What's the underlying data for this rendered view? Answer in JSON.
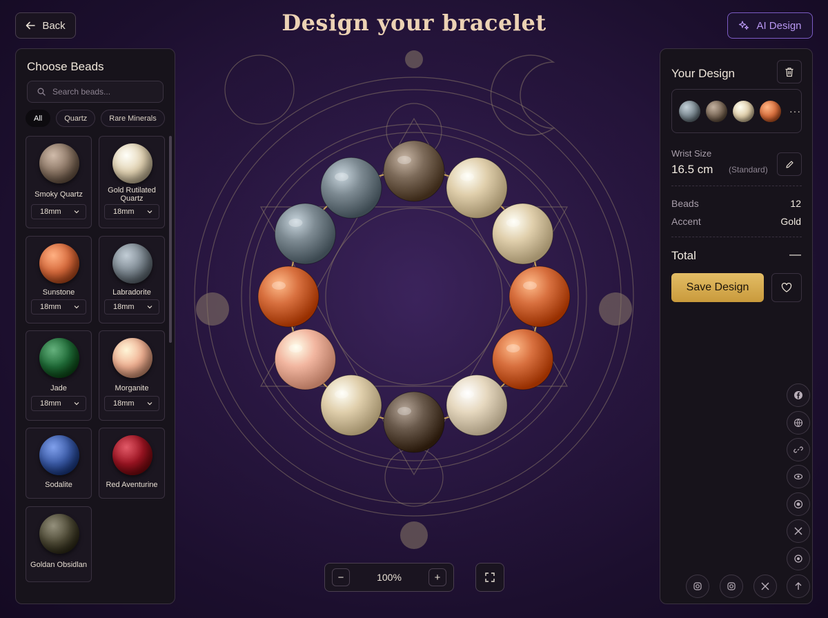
{
  "header": {
    "back_label": "Back",
    "title": "Design your bracelet",
    "ai_label": "AI Design"
  },
  "colors": {
    "accent_gold": "#d4aa52",
    "accent_purple": "#8e6ad8",
    "panel_bg": "#17131b",
    "background": "#2a1742"
  },
  "left_panel": {
    "title": "Choose Beads",
    "search_placeholder": "Search beads...",
    "filters": [
      "All",
      "Quartz",
      "Rare Minerals"
    ],
    "active_filter": "All",
    "beads": [
      {
        "name": "Smoky Quartz",
        "size": "18mm",
        "color": "#8a7564"
      },
      {
        "name": "Gold Rutilated Quartz",
        "size": "18mm",
        "color": "#e2d3b3"
      },
      {
        "name": "Sunstone",
        "size": "18mm",
        "color": "#d76a3c"
      },
      {
        "name": "Labradorite",
        "size": "18mm",
        "color": "#7c8790"
      },
      {
        "name": "Jade",
        "size": "18mm",
        "color": "#1f6b37"
      },
      {
        "name": "Morganite",
        "size": "18mm",
        "color": "#f0b092"
      },
      {
        "name": "Sodalite",
        "size": "",
        "color": "#3a5aa6"
      },
      {
        "name": "Red Aventurine",
        "size": "",
        "color": "#9c1422"
      },
      {
        "name": "Goldan Obsidlan",
        "size": "",
        "color": "#4e4a36"
      }
    ]
  },
  "canvas": {
    "bracelet_beads": [
      {
        "stone": "Smoky Quartz",
        "color": "#7d6b5a"
      },
      {
        "stone": "Gold Rutilated Quartz",
        "color": "#e0cfac"
      },
      {
        "stone": "Gold Rutilated Quartz",
        "color": "#e0cfac"
      },
      {
        "stone": "Sunstone",
        "color": "#d8703f"
      },
      {
        "stone": "Sunstone",
        "color": "#d8703f"
      },
      {
        "stone": "Gold Rutilated Quartz",
        "color": "#e6d8bf"
      },
      {
        "stone": "Smoky Quartz",
        "color": "#6a5a4c"
      },
      {
        "stone": "Gold Rutilated Quartz",
        "color": "#e0cfac"
      },
      {
        "stone": "Morganite",
        "color": "#f2b6a0"
      },
      {
        "stone": "Sunstone",
        "color": "#d8703f"
      },
      {
        "stone": "Labradorite",
        "color": "#7d8a92"
      },
      {
        "stone": "Labradorite",
        "color": "#7d8a92"
      }
    ],
    "zoom": "100%",
    "zoom_out_label": "−",
    "zoom_in_label": "+"
  },
  "right_panel": {
    "title": "Your Design",
    "preview_beads": [
      "#7d8a92",
      "#7d6b5a",
      "#e0cfac",
      "#d8703f"
    ],
    "more_label": "···",
    "wrist_label": "Wrist Size",
    "wrist_value": "16.5 cm",
    "wrist_note": "(Standard)",
    "beads_label": "Beads",
    "beads_value": "12",
    "accent_label": "Accent",
    "accent_value": "Gold",
    "total_label": "Total",
    "total_value": "—",
    "save_label": "Save Design"
  },
  "social_icons": [
    "facebook-icon",
    "globe-icon",
    "link-icon",
    "eye-icon",
    "target-icon",
    "x-icon",
    "circle-icon",
    "instagram-icon",
    "instagram-icon",
    "x-icon",
    "arrow-up-icon"
  ]
}
